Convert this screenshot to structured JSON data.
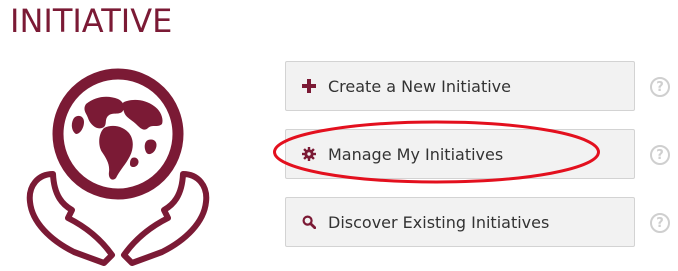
{
  "colors": {
    "accent": "#7b1a35",
    "highlight": "#e3101e"
  },
  "header": {
    "title": "INITIATIVE"
  },
  "logo": {
    "icon": "globe-in-hands-icon"
  },
  "actions": [
    {
      "label": "Create a New Initiative",
      "icon": "plus-icon",
      "help": "?"
    },
    {
      "label": "Manage My Initiatives",
      "icon": "gear-icon",
      "help": "?"
    },
    {
      "label": "Discover Existing Initiatives",
      "icon": "search-icon",
      "help": "?"
    }
  ]
}
